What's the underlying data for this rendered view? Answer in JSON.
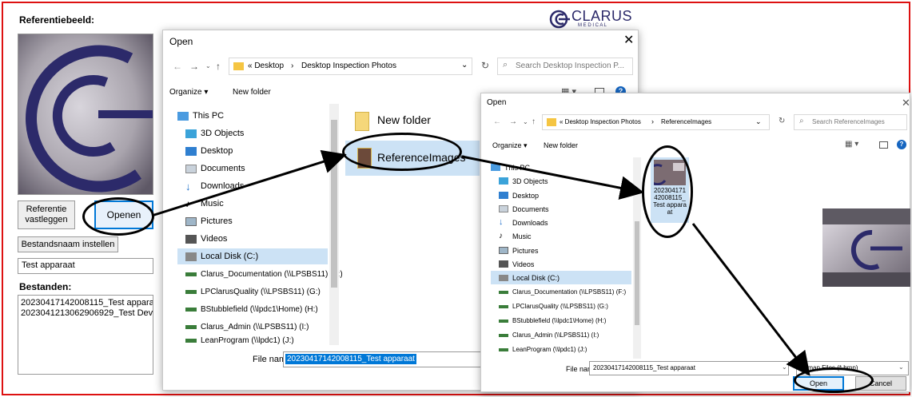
{
  "app": {
    "ref_label": "Referentiebeeld:",
    "btn_capture": "Referentie vastleggen",
    "btn_open": "Openen",
    "btn_set_name": "Bestandsnaam instellen",
    "name_value": "Test apparaat",
    "files_label": "Bestanden:",
    "files": [
      "20230417142008115_Test apparaat.b",
      "20230412130629‌06929_Test Device."
    ],
    "logo": "CLARUS",
    "logo_sub": "M E D I C A L"
  },
  "dialog1": {
    "title": "Open",
    "path": [
      "« Desktop",
      "Desktop Inspection Photos"
    ],
    "search_placeholder": "Search Desktop Inspection P...",
    "organize": "Organize ▾",
    "new_folder": "New folder",
    "nav": [
      "This PC",
      "3D Objects",
      "Desktop",
      "Documents",
      "Downloads",
      "Music",
      "Pictures",
      "Videos",
      "Local Disk (C:)",
      "Clarus_Documentation (\\\\LPSBS11) (F:)",
      "LPClarusQuality (\\\\LPSBS11) (G:)",
      "BStubblefield (\\\\lpdc1\\Home) (H:)",
      "Clarus_Admin (\\\\LPSBS11) (I:)",
      "LeanProgram (\\\\lpdc1) (J:)"
    ],
    "items": [
      "New folder",
      "ReferenceImages"
    ],
    "filename_label": "File name:",
    "filename_value": "20230417142008115_Test apparaat"
  },
  "dialog2": {
    "title": "Open",
    "path": [
      "« Desktop Inspection Photos",
      "ReferenceImages"
    ],
    "search_placeholder": "Search ReferenceImages",
    "organize": "Organize ▾",
    "new_folder": "New folder",
    "nav": [
      "This PC",
      "3D Objects",
      "Desktop",
      "Documents",
      "Downloads",
      "Music",
      "Pictures",
      "Videos",
      "Local Disk (C:)",
      "Clarus_Documentation (\\\\LPSBS11) (F:)",
      "LPClarusQuality (\\\\LPSBS11) (G:)",
      "BStubblefield (\\\\lpdc1\\Home) (H:)",
      "Clarus_Admin (\\\\LPSBS11) (I:)",
      "LeanProgram (\\\\lpdc1) (J:)"
    ],
    "file_caption": "20230417142008115_Test apparaat",
    "filename_label": "File name:",
    "filename_value": "20230417142008115_Test apparaat",
    "filetype": "Bitmap Files (*.bmp)",
    "open_btn": "Open",
    "cancel_btn": "Cancel"
  },
  "colors": {
    "frame": "#dd1111",
    "accent": "#0078d7",
    "folder": "#f5c542",
    "selection": "#cce2f5"
  }
}
